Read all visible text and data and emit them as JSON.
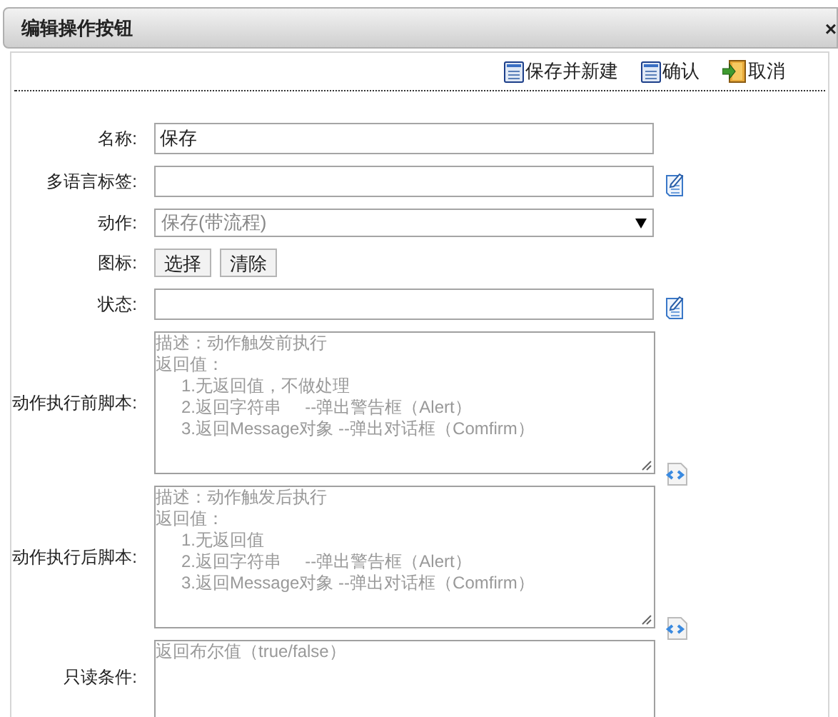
{
  "window": {
    "title": "编辑操作按钮",
    "close": "×"
  },
  "toolbar": [
    {
      "kind": "save",
      "label": "保存并新建"
    },
    {
      "kind": "save",
      "label": "确认"
    },
    {
      "kind": "exit",
      "label": "取消"
    }
  ],
  "fields": [
    {
      "kind": "text",
      "label": "名称:",
      "value": "保存"
    },
    {
      "kind": "text",
      "label": "多语言标签:",
      "icon": true
    },
    {
      "kind": "select",
      "label": "动作:",
      "value": "保存(带流程)"
    },
    {
      "kind": "buttons",
      "label": "图标:",
      "buttons": [
        "选择",
        "清除"
      ]
    },
    {
      "kind": "text",
      "label": "状态:",
      "icon": true
    },
    {
      "kind": "script",
      "label": "动作执行前脚本:",
      "placeholder": [
        {
          "kind": "line",
          "text": "描述：动作触发前执行"
        },
        {
          "kind": "line",
          "text": "返回值："
        },
        {
          "kind": "item",
          "text": "1.无返回值，不做处理"
        },
        {
          "kind": "item",
          "text": "2.返回字符串     --弹出警告框（Alert）"
        },
        {
          "kind": "item",
          "text": "3.返回Message对象 --弹出对话框（Comfirm）"
        }
      ]
    },
    {
      "kind": "script",
      "label": "动作执行后脚本:",
      "placeholder": [
        {
          "kind": "line",
          "text": "描述：动作触发后执行"
        },
        {
          "kind": "line",
          "text": "返回值："
        },
        {
          "kind": "item",
          "text": "1.无返回值"
        },
        {
          "kind": "item",
          "text": "2.返回字符串     --弹出警告框（Alert）"
        },
        {
          "kind": "item",
          "text": "3.返回Message对象 --弹出对话框（Comfirm）"
        }
      ]
    },
    {
      "kind": "condition",
      "label": "只读条件:",
      "placeholder": [
        {
          "kind": "line",
          "text": "返回布尔值（true/false）"
        }
      ]
    }
  ]
}
